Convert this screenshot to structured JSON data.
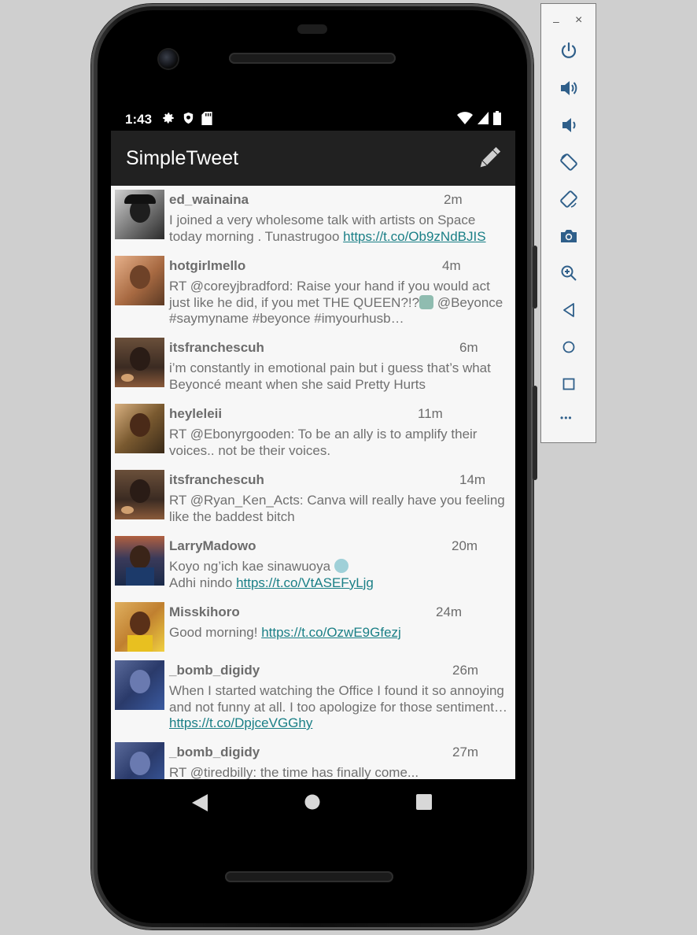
{
  "status_bar": {
    "time": "1:43"
  },
  "app": {
    "title": "SimpleTweet"
  },
  "tweets": [
    {
      "user": "ed_wainaina",
      "time": "2m",
      "text": "I joined a very wholesome talk with artists on Space today morning . Tunastrugoo ",
      "link": "https://t.co/Ob9zNdBJIS"
    },
    {
      "user": "hotgirlmello",
      "time": "4m",
      "text": "RT @coreyjbradford: Raise your hand if you would act just like he did, if you met THE QUEEN?!?",
      "text_after_emoji": " @Beyonce #saymyname #beyonce #imyourhusb…"
    },
    {
      "user": "itsfranchescuh",
      "time": "6m",
      "text": "i’m constantly in emotional pain but i guess that’s what Beyoncé meant when she said Pretty Hurts"
    },
    {
      "user": "heyleleii",
      "time": "11m",
      "text": "RT @Ebonyrgooden: To be an ally is to amplify their voices.. not be their voices."
    },
    {
      "user": "itsfranchescuh",
      "time": "14m",
      "text": "RT @Ryan_Ken_Acts: Canva will really have you feeling like the baddest bitch"
    },
    {
      "user": "LarryMadowo",
      "time": "20m",
      "text": "Koyo ng’ich kae sinawuoya ",
      "text_line2": "Adhi nindo ",
      "link": "https://t.co/VtASEFyLjg"
    },
    {
      "user": "Misskihoro",
      "time": "24m",
      "text": "Good morning! ",
      "link": "https://t.co/OzwE9Gfezj"
    },
    {
      "user": "_bomb_digidy",
      "time": "26m",
      "text": "When I started watching the Office I found it so annoying and not funny at all. I too apologize for those sentiment… ",
      "link": "https://t.co/DpjceVGGhy"
    },
    {
      "user": "_bomb_digidy",
      "time": "27m",
      "text": "RT @tiredbilly: the time has finally come..."
    }
  ],
  "emulator_toolbar": {
    "minimize": "–",
    "close": "×",
    "more": "•••"
  },
  "colors": {
    "app_bar": "#212121",
    "feed_bg": "#f7f7f7",
    "link": "#1a7f86",
    "text": "#707070"
  }
}
